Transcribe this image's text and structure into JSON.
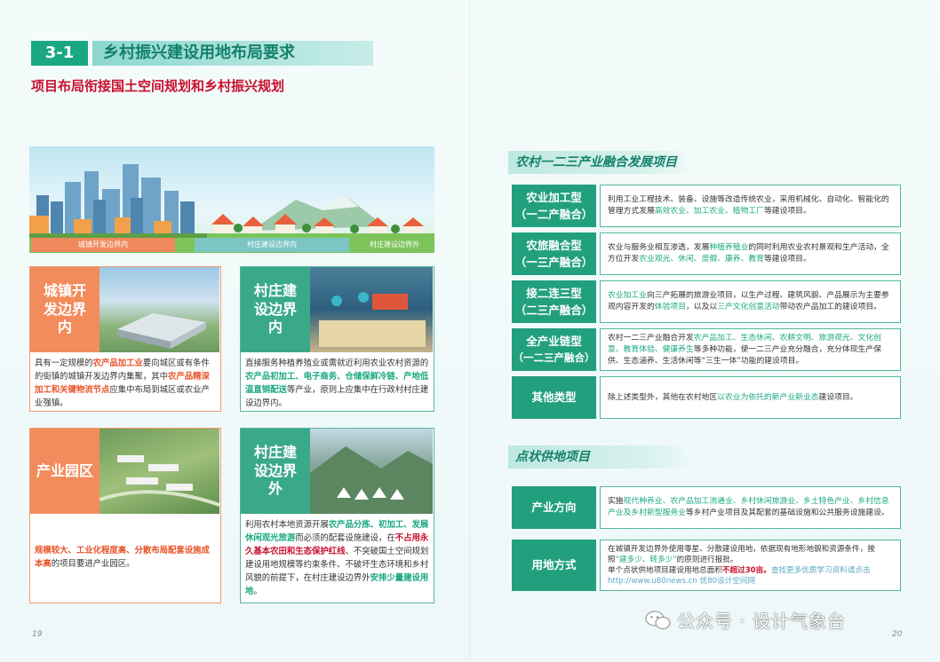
{
  "header": {
    "section_number": "3-1",
    "section_title": "乡村振兴建设用地布局要求",
    "subtitle": "项目布局衔接国土空间规划和乡村振兴规划"
  },
  "zones": {
    "town": "城镇开发边界内",
    "village": "村庄建设边界内",
    "outside": "村庄建设边界外"
  },
  "cards": [
    {
      "label": "城镇开发边界内",
      "p1": "具有一定规模的",
      "h1": "农产品加工业",
      "p2": "要向城区或有条件的街镇的城镇开发边界内集聚，其中",
      "h2": "农产品精深加工和关键物流节点",
      "p3": "应集中布局到城区或农业产业强镇。"
    },
    {
      "label": "村庄建设边界内",
      "p1": "直接服务种植养殖业或需就近利用农业农村资源的",
      "h1": "农产品初加工、电子商务、仓储保鲜冷链、产地低温直销配送",
      "p2": "等产业，原则上应集中在行政村村庄建设边界内。"
    },
    {
      "label": "产业园区",
      "h1": "规模较大、工业化程度高、分散布局配套设施成本高",
      "p1": "的项目要进产业园区。"
    },
    {
      "label": "村庄建设边界外",
      "p1": "利用农村本地资源开展",
      "h1": "农产品分拣、初加工、发展休闲观光旅游",
      "p2": "而必须的配套设施建设，在",
      "h2": "不占用永久基本农田和生态保护红线",
      "p3": "、不突破国土空间规划建设用地规模等约束条件、不破坏生态环境和乡村风貌的前提下，在村庄建设边界外",
      "h3": "安排少量建设用地",
      "p4": "。"
    }
  ],
  "fusion": {
    "title": "农村一二三产业融合发展项目",
    "rows": [
      {
        "label1": "农业加工型",
        "label2": "（一二产融合）",
        "t1": "利用工业工程技术、装备、设施等改造传统农业，采用机械化、自动化、智能化的管理方式发展",
        "g1": "高效农业、加工农业、植物工厂",
        "t2": "等建设项目。"
      },
      {
        "label1": "农旅融合型",
        "label2": "（一三产融合）",
        "t1": "农业与服务业相互渗透，发展",
        "g1": "种植养殖业",
        "t2": "的同时利用农业农村景观和生产活动，全方位开发",
        "g2": "农业观光、休闲、度假、康养、教育",
        "t3": "等建设项目。"
      },
      {
        "label1": "接二连三型",
        "label2": "（二三产融合）",
        "g1": "农业加工业",
        "t1": "向三产拓展的旅游业项目，以生产过程、建筑风貌、产品展示为主要参观内容开发的",
        "g2": "体验项目",
        "t2": "，以及以",
        "g3": "三产文化创意活动",
        "t3": "带动农产品加工的建设项目。"
      },
      {
        "label1": "全产业链型",
        "label2": "（一二三产融合）",
        "t1": "农村一二三产业融合开发",
        "g1": "农产品加工、生态休闲、农耕文明、旅游观光、文化创意、教育体验、健康养生",
        "t2": "等多种功能，使一二三产业充分融合，充分体现生产保供、生态涵养、生活休闲等“三生一体”功能的建设项目。"
      },
      {
        "label1": "其他类型",
        "t1": "除上述类型外，其他在农村地区",
        "g1": "以农业为依托的新产业新业态",
        "t2": "建设项目。"
      }
    ]
  },
  "point_supply": {
    "title": "点状供地项目",
    "rows": [
      {
        "label": "产业方向",
        "t1": "实施",
        "g1": "现代种养业、农产品加工流通业、乡村休闲旅游业、乡土特色产业、乡村信息产业及乡村新型服务业",
        "t2": "等乡村产业项目及其配套的基础设施和公共服务设施建设。"
      },
      {
        "label": "用地方式",
        "t1": "在城镇开发边界外使用零星、分散建设用地，依据现有地形地貌和资源条件，按照",
        "g1": "“建多少、转多少”",
        "t2": "的原则进行报批。",
        "t3": "单个点状供地项目建设用地总面积",
        "r1": "不超过30亩。",
        "lk1": "查找更多优质学习资料请点击 http://www.u80news.cn 优80设计空间网"
      }
    ]
  },
  "page_left": "19",
  "page_right": "20",
  "watermark": "公众号 · 设计气象台",
  "colors": {
    "accent_green": "#1aa882",
    "accent_orange": "#f28c5c",
    "accent_red": "#c8102e"
  }
}
